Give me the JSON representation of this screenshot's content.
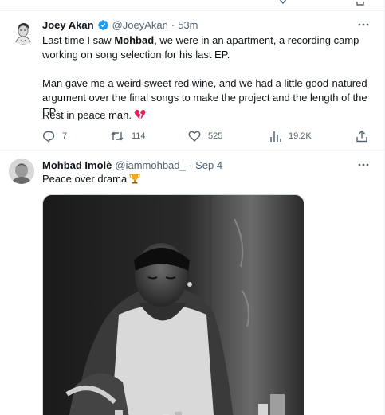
{
  "tweets": [
    {
      "display_name": "Joey Akan",
      "verified": true,
      "handle": "@JoeyAkan",
      "separator": "·",
      "time": "53m",
      "paragraphs": {
        "p1_before": "Last time I saw ",
        "p1_bold": "Mohbad",
        "p1_after": ", we were in an apartment, a recording camp working on song selection for his last EP.",
        "p2": "Man gave me a weird sweet red wine, and we had a little good-natured argument over the final songs to make the project and the length of the EP.",
        "p3": "Rest in peace man."
      },
      "text_emoji": "broken-heart-icon",
      "stats": {
        "replies": "7",
        "reposts": "114",
        "likes": "525",
        "views": "19.2K"
      }
    },
    {
      "display_name": "Mohbad Imolè",
      "verified": false,
      "handle": "@iammohbad_",
      "separator": "·",
      "time": "Sep 4",
      "text": "Peace over drama",
      "text_emoji": "trophy-icon",
      "media_icon": "photo-icon"
    }
  ],
  "icons": {
    "more": "more-icon",
    "reply": "reply-icon",
    "repost": "repost-icon",
    "like": "like-icon",
    "views": "views-icon",
    "share": "share-icon",
    "verified": "verified-badge-icon"
  },
  "colors": {
    "text": "#0f1419",
    "secondary": "#536471",
    "verified_blue": "#1d9bf0",
    "border": "#eff3f4",
    "broken_heart": "#e0245e",
    "trophy": "#f5a623"
  }
}
